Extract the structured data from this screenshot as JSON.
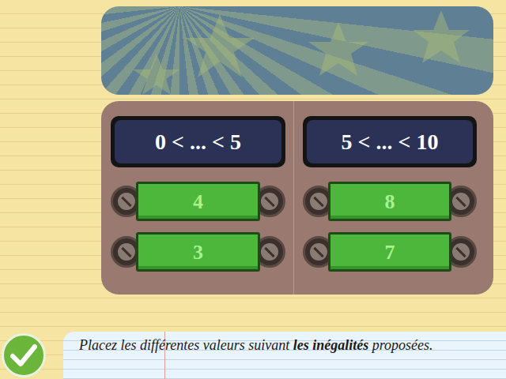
{
  "columns": [
    {
      "inequality": "0 < ... < 5",
      "values": [
        "4",
        "3"
      ]
    },
    {
      "inequality": "5 < ... < 10",
      "values": [
        "8",
        "7"
      ]
    }
  ],
  "instruction": {
    "before": "Placez les différentes valeurs suivant ",
    "bold": "les inégalités",
    "after": " proposées."
  }
}
